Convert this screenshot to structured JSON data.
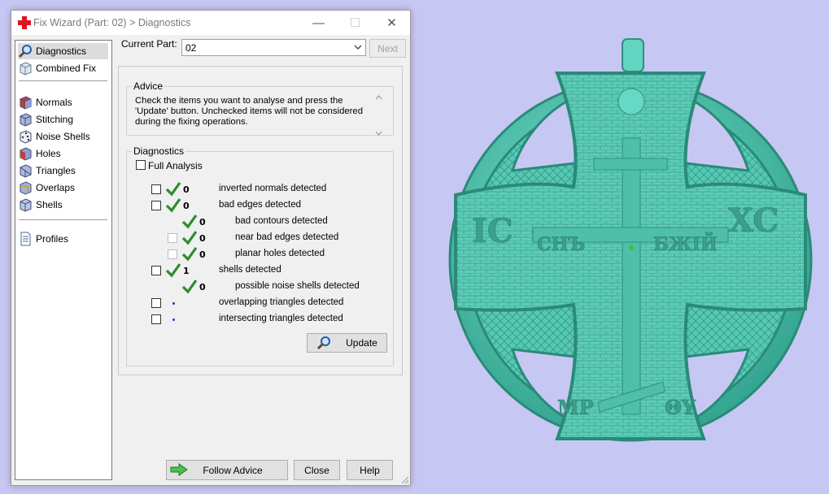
{
  "window": {
    "title": "Fix Wizard (Part: 02) > Diagnostics",
    "minimize_glyph": "—",
    "maximize_glyph": "☐",
    "close_glyph": "✕"
  },
  "sidebar": {
    "items": [
      {
        "label": "Diagnostics",
        "icon": "magnifier-icon"
      },
      {
        "label": "Combined Fix",
        "icon": "cube-icon"
      },
      {
        "label": "Normals",
        "icon": "cube-icon"
      },
      {
        "label": "Stitching",
        "icon": "cube-icon"
      },
      {
        "label": "Noise Shells",
        "icon": "dice-icon"
      },
      {
        "label": "Holes",
        "icon": "cube-icon"
      },
      {
        "label": "Triangles",
        "icon": "cube-icon"
      },
      {
        "label": "Overlaps",
        "icon": "cube-icon"
      },
      {
        "label": "Shells",
        "icon": "cube-icon"
      },
      {
        "label": "Profiles",
        "icon": "document-icon"
      }
    ]
  },
  "toolbar": {
    "current_part_label": "Current Part:",
    "current_part_value": "02",
    "next_label": "Next"
  },
  "advice": {
    "legend": "Advice",
    "text": "Check the items you want to analyse and press the 'Update' button. Unchecked items will not be considered during the fixing operations."
  },
  "diagnostics": {
    "legend": "Diagnostics",
    "full_analysis_label": "Full Analysis",
    "rows": [
      {
        "count": "0",
        "label": "inverted normals detected",
        "status": "ok"
      },
      {
        "count": "0",
        "label": "bad edges detected",
        "status": "ok"
      },
      {
        "count": "0",
        "label": "bad contours detected",
        "status": "ok"
      },
      {
        "count": "0",
        "label": "near bad edges detected",
        "status": "ok"
      },
      {
        "count": "0",
        "label": "planar holes detected",
        "status": "ok"
      },
      {
        "count": "1",
        "label": "shells detected",
        "status": "ok"
      },
      {
        "count": "0",
        "label": "possible noise shells detected",
        "status": "ok"
      },
      {
        "count": "",
        "label": "overlapping triangles detected",
        "status": "not-checked"
      },
      {
        "count": "",
        "label": "intersecting triangles detected",
        "status": "not-checked"
      }
    ],
    "update_label": "Update"
  },
  "footer": {
    "follow_advice_label": "Follow Advice",
    "close_label": "Close",
    "help_label": "Help"
  },
  "viewport": {
    "background": "#c7c7f3",
    "model_color": "#5ed6c0",
    "pendant_letters": [
      "IC",
      "CHЪ",
      "БЖIЙ",
      "XC",
      "MP",
      "ΘY"
    ]
  }
}
